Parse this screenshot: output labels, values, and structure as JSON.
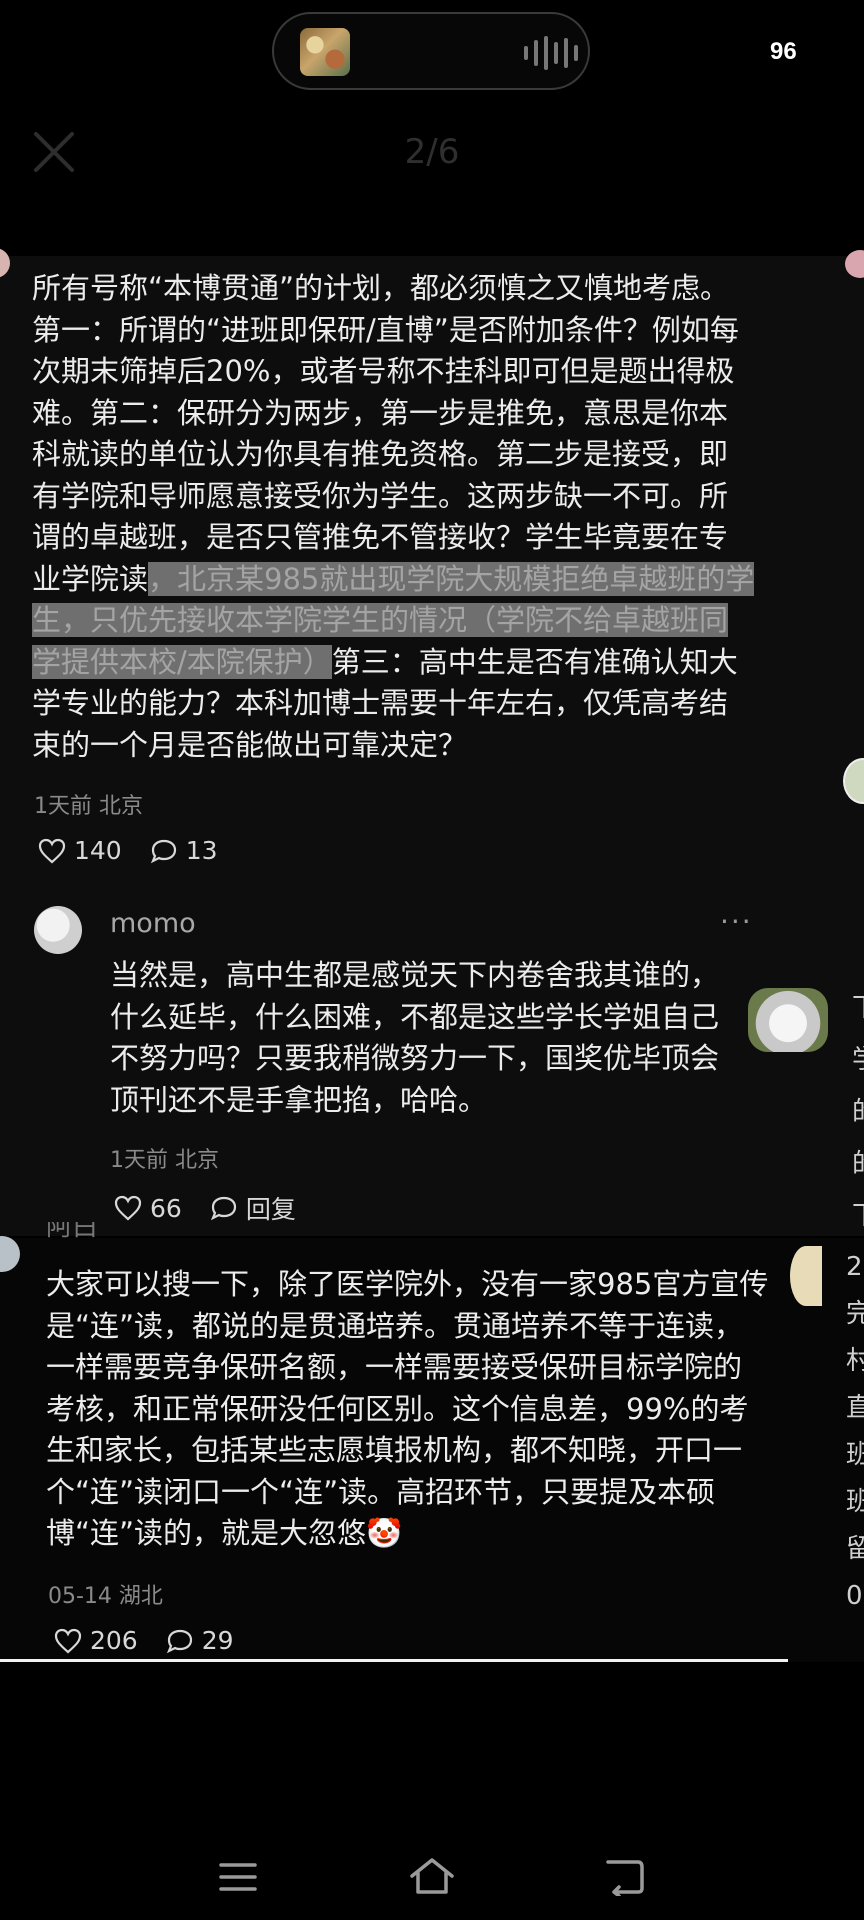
{
  "status_bar": {
    "battery": "96"
  },
  "viewer": {
    "page_counter": "2/6"
  },
  "comment1": {
    "text_before": "所有号称“本博贯通”的计划，都必须慎之又慎地考虑。第一：所谓的“进班即保研/直博”是否附加条件？例如每次期末筛掉后20%，或者号称不挂科即可但是题出得极难。第二：保研分为两步，第一步是推免，意思是你本科就读的单位认为你具有推免资格。第二步是接受，即有学院和导师愿意接受你为学生。这两步缺一不可。所谓的卓越班，是否只管推免不管接收？学生毕竟要在专业学院读",
    "text_highlight": "，北京某985就出现学院大规模拒绝卓越班的学生，只优先接收本学院学生的情况（学院不给卓越班同学提供本校/本院保护）",
    "text_after": "第三：高中生是否有准确认知大学专业的能力？本科加博士需要十年左右，仅凭高考结束的一个月是否能做出可靠决定？",
    "meta": "1天前 北京",
    "likes": "140",
    "comments": "13"
  },
  "reply1": {
    "username": "momo",
    "text": "当然是，高中生都是感觉天下内卷舍我其谁的，什么延毕，什么困难，不都是这些学长学姐自己不努力吗？只要我稍微努力一下，国奖优毕顶会顶刊还不是手拿把掐，哈哈。",
    "meta": "1天前 北京",
    "likes": "66",
    "reply_label": "回复"
  },
  "comment2": {
    "username_partial": "阿白",
    "text": "大家可以搜一下，除了医学院外，没有一家985官方宣传是“连”读，都说的是贯通培养。贯通培养不等于连读，一样需要竞争保研名额，一样需要接受保研目标学院的考核，和正常保研没任何区别。这个信息差，99%的考生和家长，包括某些志愿填报机构，都不知晓，开口一个“连”读闭口一个“连”读。高招环节，只要提及本硕博“连”读的，就是大忽悠",
    "emoji": "🤡",
    "meta": "05-14 湖北",
    "likes": "206",
    "comments": "29"
  },
  "edge_fragments": {
    "right_reply": [
      "下",
      "学",
      "的",
      "的",
      "下"
    ],
    "right_c2": [
      "2",
      "完",
      "村",
      "直",
      "班",
      "班",
      "留",
      "0"
    ]
  }
}
